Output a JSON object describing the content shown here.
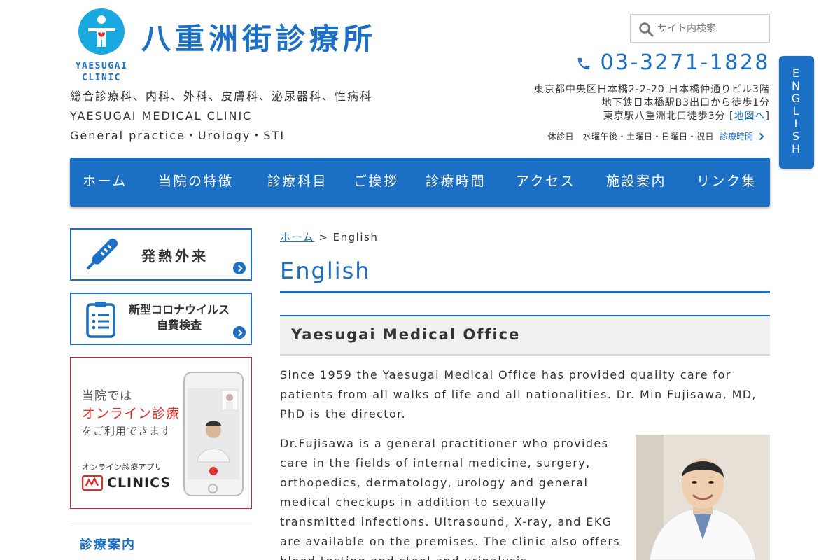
{
  "header": {
    "logo_en_line1": "YAESUGAI",
    "logo_en_line2": "CLINIC",
    "logo_ja": "八重洲街診療所",
    "departments": "総合診療科、内科、外科、皮膚科、泌尿器科、性病科",
    "name_en": "YAESUGAI MEDICAL CLINIC",
    "specialties_en": "General practice・Urology・STI",
    "search_placeholder": "サイト内検索",
    "phone": "03-3271-1828",
    "address_line1": "東京都中央区日本橋2-2-20 日本橋仲通りビル3階",
    "address_line2": "地下鉄日本橋駅B3出口から徒歩1分",
    "address_line3_prefix": "東京駅八重洲北口徒歩3分 [",
    "address_map_link": "地図へ",
    "address_line3_suffix": "]",
    "holiday": "休診日　水曜午後・土曜日・日曜日・祝日",
    "hours_link": "診療時間",
    "english_tab": [
      "E",
      "N",
      "G",
      "L",
      "I",
      "S",
      "H"
    ]
  },
  "nav": {
    "items": [
      "ホーム",
      "当院の特徴",
      "診療科目",
      "ご挨拶",
      "診療時間",
      "アクセス",
      "施設案内",
      "リンク集"
    ]
  },
  "sidebar": {
    "fever_banner": "発熱外来",
    "covid_banner_line1": "新型コロナウイルス",
    "covid_banner_line2": "自費検査",
    "online_line1": "当院では",
    "online_line2": "オンライン診療",
    "online_line3": "をご利用できます",
    "online_app_label": "オンライン診療アプリ",
    "online_app_name": "CLINICS",
    "section_heading": "診療案内"
  },
  "main": {
    "breadcrumb_home": "ホーム",
    "breadcrumb_sep": " > ",
    "breadcrumb_current": "English",
    "page_title": "English",
    "section_title": "Yaesugai Medical Office",
    "paragraph1": "Since 1959 the Yaesugai Medical Office has provided quality care for patients from all walks of life and all nationalities. Dr. Min Fujisawa, MD, PhD is the director.",
    "paragraph2": "Dr.Fujisawa is a general practitioner who provides care in the fields of internal medicine, surgery, orthopedics, dermatology, urology and general medical checkups in addition to sexually transmitted infections. Ultrasound, X-ray, and EKG are available on the premises. The clinic also offers blood testing and stool and urinalysis."
  },
  "colors": {
    "brand_blue": "#1b6fc4",
    "logo_cyan": "#19a8e0",
    "online_red": "#e0302b"
  }
}
